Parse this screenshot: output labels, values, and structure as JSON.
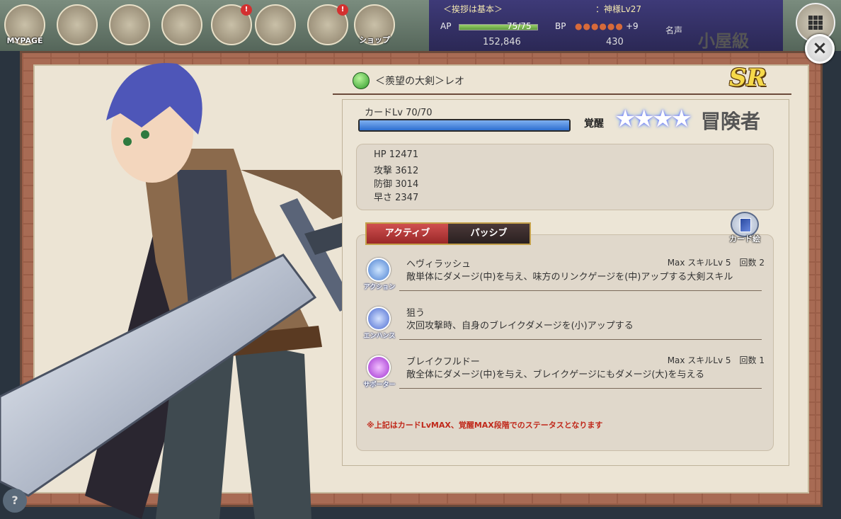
{
  "hud": {
    "buttons": [
      {
        "label": "MYPAGE",
        "badge": ""
      },
      {
        "label": "",
        "badge": ""
      },
      {
        "label": "",
        "badge": ""
      },
      {
        "label": "",
        "badge": ""
      },
      {
        "label": "",
        "badge": "!"
      },
      {
        "label": "",
        "badge": ""
      },
      {
        "label": "",
        "badge": "!"
      },
      {
        "label": "ショップ",
        "badge": ""
      }
    ]
  },
  "player": {
    "title": "＜挨拶は基本＞",
    "rank": "：神様Lv27",
    "ap_label": "AP",
    "ap_value": "75/75",
    "ap_fraction": 1.0,
    "bp_label": "BP",
    "bp_dots": "●●●●●●",
    "bp_plus": "+9",
    "gold": "152,846",
    "gems": "430",
    "fame_label": "名声",
    "fame_rank": "小屋級"
  },
  "close_label": "×",
  "card": {
    "element": "green",
    "name": "＜羨望の大剣＞レオ",
    "rarity": "SR",
    "level_label": "カードLv 70/70",
    "level_fraction": 1.0,
    "awake_label": "覚醒",
    "stars": "★★★★",
    "class": "冒険者",
    "stats": [
      {
        "text": "HP 12471"
      },
      {
        "text": "攻撃 3612"
      },
      {
        "text": "防御 3014"
      },
      {
        "text": "早さ 2347"
      }
    ],
    "tabs": {
      "active": "アクティブ",
      "passive": "パッシブ"
    },
    "card_art_label": "カード絵",
    "skills": [
      {
        "type": "アクション",
        "icon": "action-icon",
        "name": "ヘヴィラッシュ",
        "meta": "Max スキルLv 5　回数 2",
        "desc": "敵単体にダメージ(中)を与え、味方のリンクゲージを(中)アップする大剣スキル"
      },
      {
        "type": "エンハンス",
        "icon": "enhance-icon",
        "name": "狙う",
        "meta": "",
        "desc": "次回攻撃時、自身のブレイクダメージを(小)アップする"
      },
      {
        "type": "サポーター",
        "icon": "support-icon",
        "name": "ブレイクフルドー",
        "meta": "Max スキルLv 5　回数 1",
        "desc": "敵全体にダメージ(中)を与え、ブレイクゲージにもダメージ(大)を与える"
      }
    ],
    "note": "※上記はカードLvMAX、覚醒MAX段階でのステータスとなります"
  },
  "help_label": "?"
}
